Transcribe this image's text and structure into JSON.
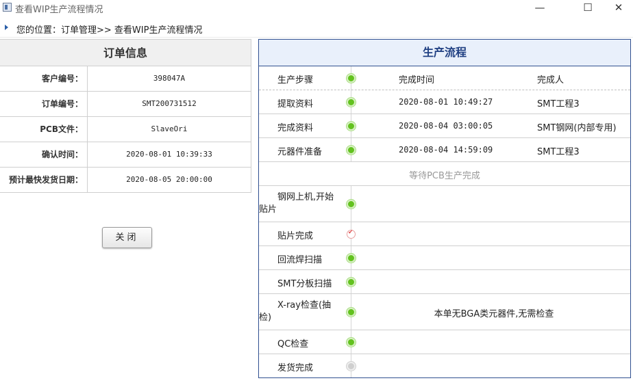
{
  "window": {
    "title": "查看WIP生产流程情况",
    "min_glyph": "—",
    "max_glyph": "☐",
    "close_glyph": "✕"
  },
  "breadcrumb": {
    "text": "您的位置：订单管理>> 查看WIP生产流程情况"
  },
  "order": {
    "heading": "订单信息",
    "rows": [
      {
        "label": "客户编号：",
        "value": "398047A"
      },
      {
        "label": "订单编号：",
        "value": "SMT200731512"
      },
      {
        "label": "PCB文件：",
        "value": "SlaveOri"
      },
      {
        "label": "确认时间：",
        "value": "2020-08-01 10:39:33"
      },
      {
        "label": "预计最快发货日期：",
        "value": "2020-08-05 20:00:00"
      }
    ],
    "close_label": "关闭"
  },
  "flow": {
    "heading": "生产流程",
    "columns": {
      "step": "生产步骤",
      "time": "完成时间",
      "person": "完成人"
    },
    "steps": [
      {
        "step": "提取资料",
        "time": "2020-08-01 10:49:27",
        "person": "SMT工程3",
        "status": "done"
      },
      {
        "step": "完成资料",
        "time": "2020-08-04 03:00:05",
        "person": "SMT钢网(内部专用)",
        "status": "done"
      },
      {
        "step": "元器件准备",
        "time": "2020-08-04 14:59:09",
        "person": "SMT工程3",
        "status": "done"
      },
      {
        "step": "钢网上机,开始贴片",
        "status": "done"
      },
      {
        "step": "贴片完成",
        "status": "checked"
      },
      {
        "step": "回流焊扫描",
        "status": "done"
      },
      {
        "step": "SMT分板扫描",
        "status": "done"
      },
      {
        "step": "X-ray检查(抽检)",
        "note": "本单无BGA类元器件,无需检查",
        "status": "done"
      },
      {
        "step": "QC检查",
        "status": "done"
      },
      {
        "step": "发货完成",
        "status": "pending"
      }
    ],
    "waiting_text": "等待PCB生产完成"
  }
}
